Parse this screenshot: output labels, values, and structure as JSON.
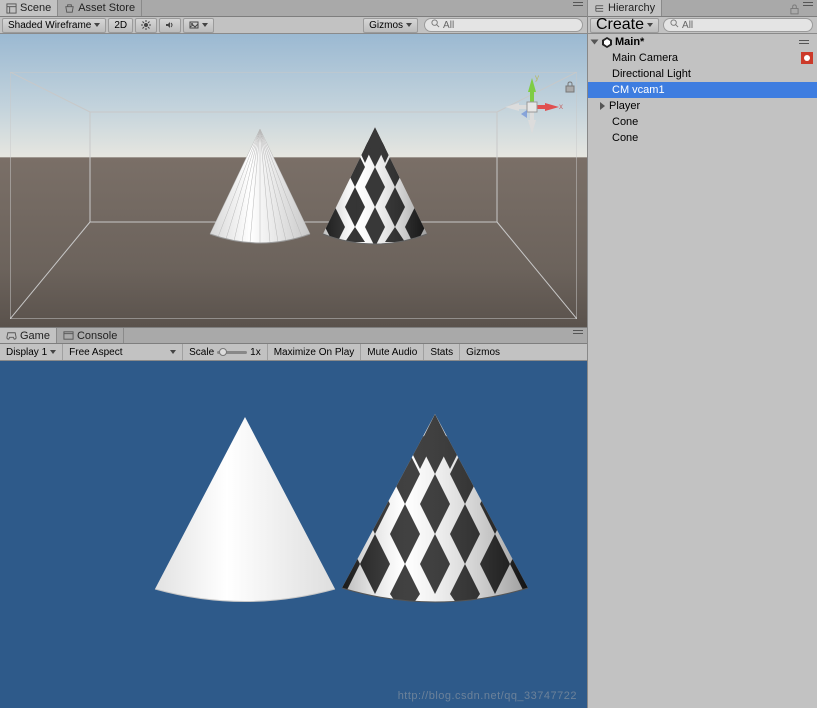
{
  "scene": {
    "tab_scene": "Scene",
    "tab_asset_store": "Asset Store",
    "shading_mode": "Shaded Wireframe",
    "btn_2d": "2D",
    "gizmos_label": "Gizmos",
    "search_placeholder": "All"
  },
  "game": {
    "tab_game": "Game",
    "tab_console": "Console",
    "display": "Display 1",
    "aspect": "Free Aspect",
    "scale_label": "Scale",
    "scale_value": "1x",
    "maximize": "Maximize On Play",
    "mute": "Mute Audio",
    "stats": "Stats",
    "gizmos": "Gizmos"
  },
  "hierarchy": {
    "tab": "Hierarchy",
    "create": "Create",
    "search_placeholder": "All",
    "scene_name": "Main*",
    "items": [
      {
        "label": "Main Camera"
      },
      {
        "label": "Directional Light"
      },
      {
        "label": "CM vcam1"
      },
      {
        "label": "Player"
      },
      {
        "label": "Cone"
      },
      {
        "label": "Cone"
      }
    ]
  },
  "watermark": "http://blog.csdn.net/qq_33747722"
}
